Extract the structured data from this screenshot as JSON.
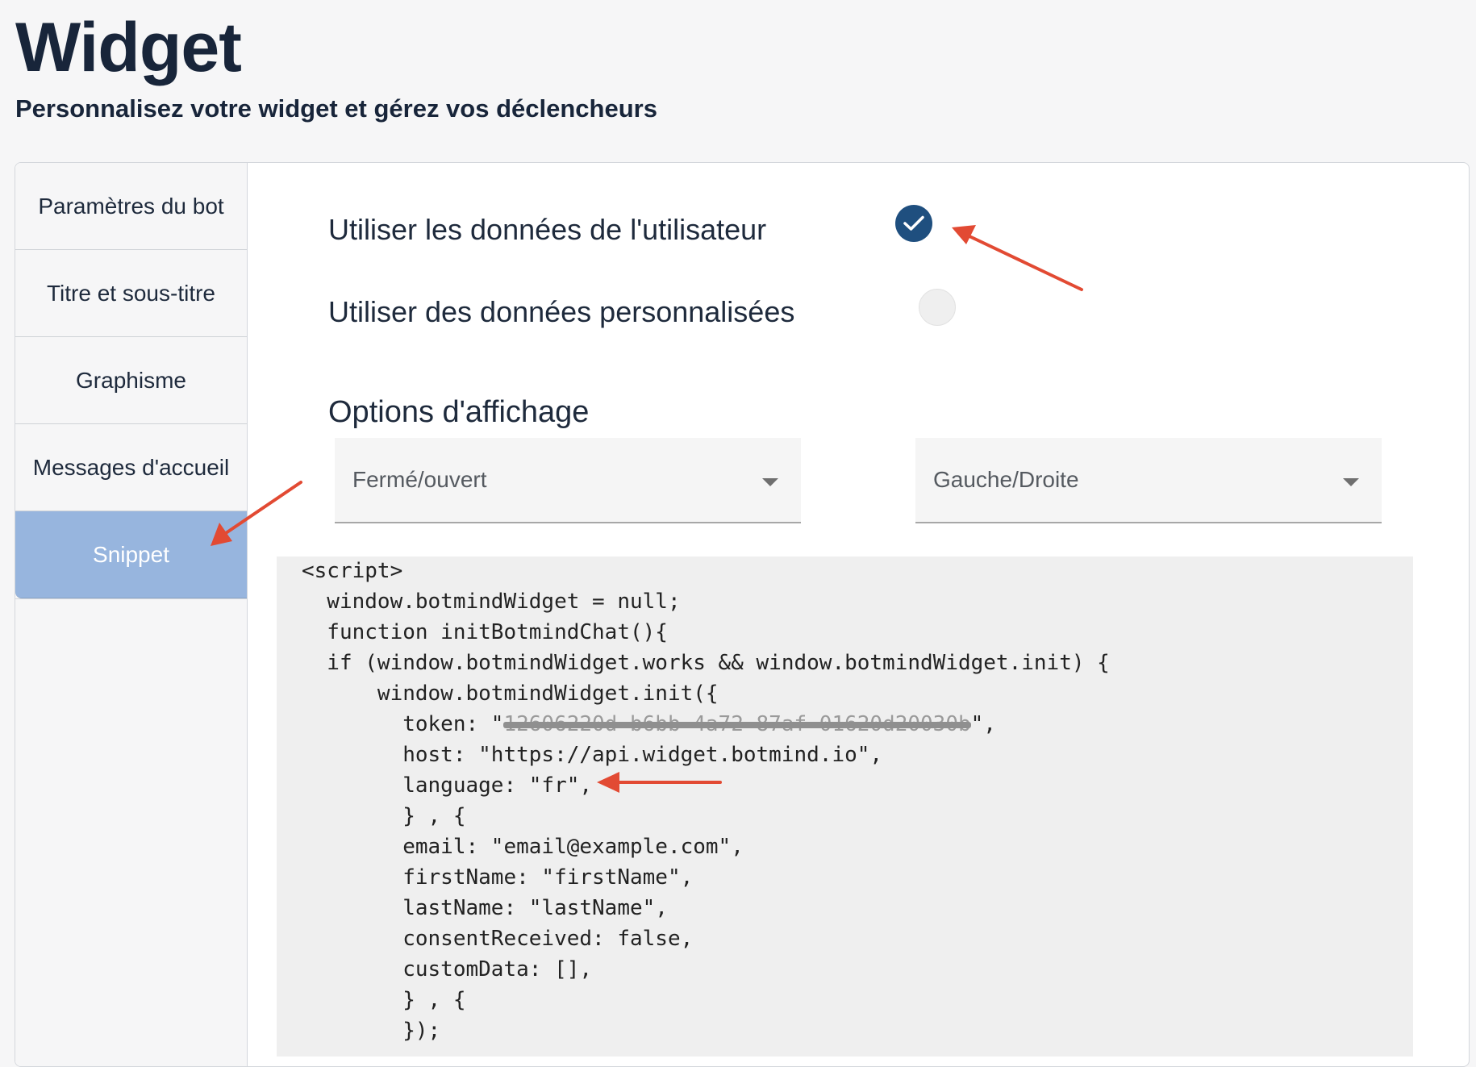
{
  "header": {
    "title": "Widget",
    "subtitle": "Personnalisez votre widget et gérez vos déclencheurs"
  },
  "sidebar": {
    "items": [
      {
        "label": "Paramètres du bot",
        "active": false
      },
      {
        "label": "Titre et sous-titre",
        "active": false
      },
      {
        "label": "Graphisme",
        "active": false
      },
      {
        "label": "Messages d'accueil",
        "active": false
      },
      {
        "label": "Snippet",
        "active": true
      }
    ]
  },
  "user_data": {
    "option_user": {
      "label": "Utiliser les données de l'utilisateur",
      "checked": true
    },
    "option_custom": {
      "label": "Utiliser des données personnalisées",
      "checked": false
    }
  },
  "display_options": {
    "heading": "Options d'affichage",
    "state_select": {
      "value": "Fermé/ouvert"
    },
    "position_select": {
      "value": "Gauche/Droite"
    }
  },
  "snippet": {
    "lines": [
      "<script>",
      "  window.botmindWidget = null;",
      "  function initBotmindChat(){",
      "  if (window.botmindWidget.works && window.botmindWidget.init) {",
      "      window.botmindWidget.init({",
      "        token: \"",
      "        host: \"https://api.widget.botmind.io\",",
      "        language: \"fr\",",
      "        } , {",
      "        email: \"email@example.com\",",
      "        firstName: \"firstName\",",
      "        lastName: \"lastName\",",
      "        consentReceived: false,",
      "        customData: [],",
      "        } , {",
      "        });"
    ],
    "token_redacted": "12606220d-b6bb-4a72-87af-01620d20030b",
    "token_suffix": "\","
  },
  "colors": {
    "accent": "#1f4f7f",
    "active_tab": "#97b5de",
    "annotation_arrow": "#e24a33"
  },
  "icons": {
    "checked_radio": "check-icon",
    "select_caret": "caret-down-icon"
  }
}
